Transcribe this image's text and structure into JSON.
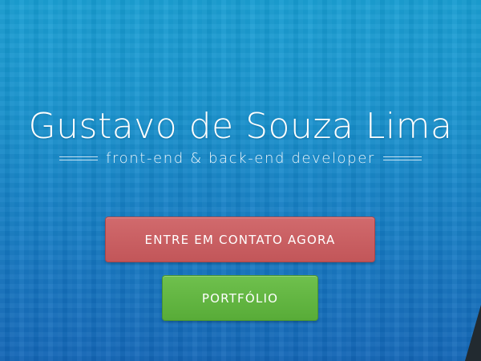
{
  "hero": {
    "title": "Gustavo de Souza Lima",
    "subtitle": "front-end & back-end developer"
  },
  "buttons": {
    "contact_label": "ENTRE EM CONTATO AGORA",
    "portfolio_label": "PORTFÓLIO"
  },
  "colors": {
    "background_top": "#179fd4",
    "background_bottom": "#1266b8",
    "contact_button": "#c85e61",
    "portfolio_button": "#62b542",
    "text": "#ffffff"
  }
}
